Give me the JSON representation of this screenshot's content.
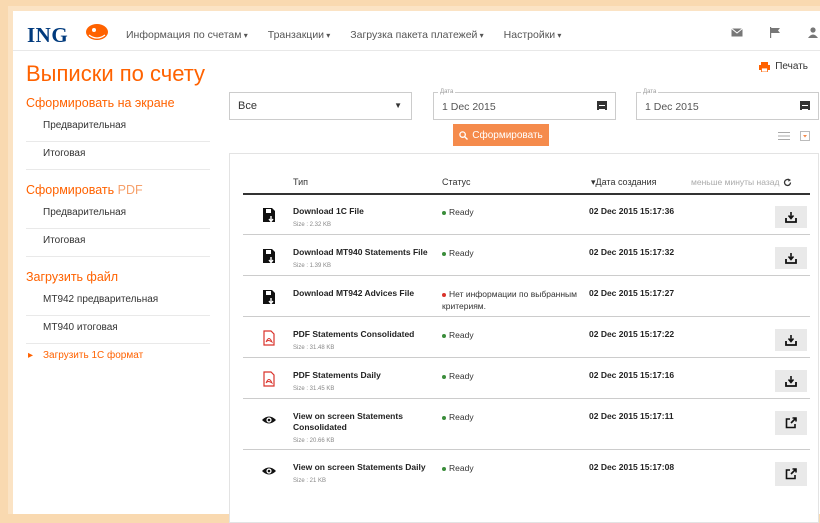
{
  "brand": {
    "logo": "ING",
    "accent": "#ff6200",
    "navy": "#003a7d"
  },
  "nav": {
    "items": [
      "Информация по счетам",
      "Транзакции",
      "Загрузка пакета платежей",
      "Настройки"
    ],
    "icons": [
      "mail-icon",
      "flag-icon",
      "user-icon"
    ]
  },
  "page": {
    "title": "Выписки по счету",
    "print_label": "Печать"
  },
  "sidebar": {
    "section1": {
      "title": "Сформировать на экране",
      "items": [
        "Предварительная",
        "Итоговая"
      ]
    },
    "section2": {
      "title": "Сформировать",
      "title_suffix": "PDF",
      "items": [
        "Предварительная",
        "Итоговая"
      ]
    },
    "section3": {
      "title": "Загрузить файл",
      "items": [
        "MT942 предварительная",
        "MT940 итоговая",
        "Загрузить 1С формат"
      ]
    }
  },
  "filters": {
    "select_value": "Все",
    "date_label": "Дата",
    "date_from": "1 Dec 2015",
    "date_to": "1 Dec 2015",
    "generate_label": "Сформировать"
  },
  "table": {
    "headers": {
      "type": "Тип",
      "status": "Статус",
      "created": "Дата создания"
    },
    "refresh_text": "меньше минуты назад",
    "rows": [
      {
        "icon": "floppy-icon",
        "name": "Download 1C File",
        "size": "Size : 2.32 KB",
        "status": "Ready",
        "status_color": "#3a8d3a",
        "date": "02 Dec 2015 15:17:36",
        "action": "download"
      },
      {
        "icon": "floppy-icon",
        "name": "Download MT940 Statements File",
        "size": "Size : 1.39 KB",
        "status": "Ready",
        "status_color": "#3a8d3a",
        "date": "02 Dec 2015 15:17:32",
        "action": "download"
      },
      {
        "icon": "floppy-icon",
        "name": "Download MT942 Advices File",
        "size": "",
        "status": "Нет информации по выбранным критериям.",
        "status_color": "#d9332b",
        "date": "02 Dec 2015 15:17:27",
        "action": ""
      },
      {
        "icon": "pdf-icon",
        "name": "PDF Statements Consolidated",
        "size": "Size : 31.48 KB",
        "status": "Ready",
        "status_color": "#3a8d3a",
        "date": "02 Dec 2015 15:17:22",
        "action": "download"
      },
      {
        "icon": "pdf-icon",
        "name": "PDF Statements Daily",
        "size": "Size : 31.45 KB",
        "status": "Ready",
        "status_color": "#3a8d3a",
        "date": "02 Dec 2015 15:17:16",
        "action": "download"
      },
      {
        "icon": "eye-icon",
        "name": "View on screen Statements Consolidated",
        "size": "Size : 20.66 KB",
        "status": "Ready",
        "status_color": "#3a8d3a",
        "date": "02 Dec 2015 15:17:11",
        "action": "open"
      },
      {
        "icon": "eye-icon",
        "name": "View on screen Statements Daily",
        "size": "Size : 21 KB",
        "status": "Ready",
        "status_color": "#3a8d3a",
        "date": "02 Dec 2015 15:17:08",
        "action": "open"
      }
    ]
  }
}
